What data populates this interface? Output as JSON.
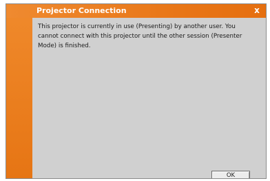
{
  "dialog": {
    "title": "Projector Connection",
    "close_label": "x",
    "message": "This projector is currently in use (Presenting) by another user. You cannot connect with this projector until the other session (Presenter Mode) is finished.",
    "ok_label": "OK"
  },
  "colors": {
    "titlebar": "#e87516",
    "left_bar": "#ee8428",
    "content_bg": "#d0d0d0"
  }
}
